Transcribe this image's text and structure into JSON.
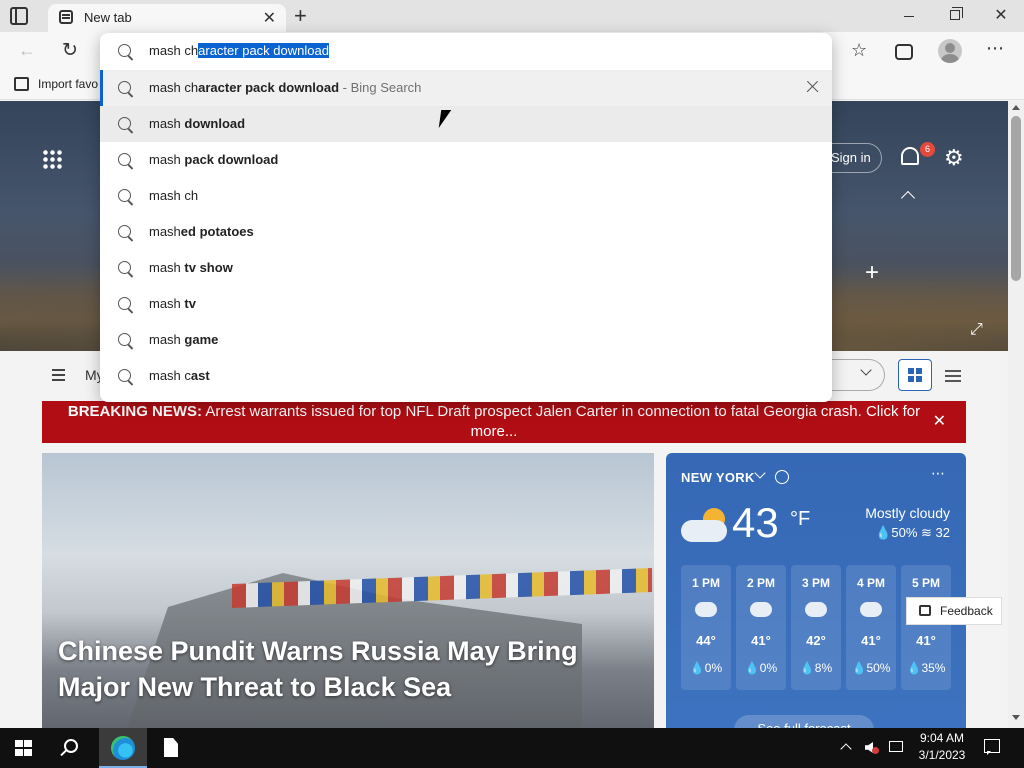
{
  "browser": {
    "tab_title": "New tab",
    "favorites_import_label": "Import favo"
  },
  "omnibox": {
    "query_typed": "mash ch",
    "query_autocomplete": "aracter pack download",
    "suggestions": [
      {
        "prefix": "mash ch",
        "bold": "aracter pack download",
        "suffix": " - Bing Search"
      },
      {
        "prefix": "mash ",
        "bold": "download",
        "suffix": ""
      },
      {
        "prefix": "mash ",
        "bold": "pack download",
        "suffix": ""
      },
      {
        "prefix": "mash ch",
        "bold": "",
        "suffix": ""
      },
      {
        "prefix": "mash",
        "bold": "ed potatoes",
        "suffix": ""
      },
      {
        "prefix": "mash ",
        "bold": "tv show",
        "suffix": ""
      },
      {
        "prefix": "mash ",
        "bold": "tv",
        "suffix": ""
      },
      {
        "prefix": "mash ",
        "bold": "game",
        "suffix": ""
      },
      {
        "prefix": "mash c",
        "bold": "ast",
        "suffix": ""
      }
    ]
  },
  "ntp": {
    "signin_label": "Sign in",
    "notification_count": "6",
    "feed_label": "My",
    "breaking_label": "BREAKING NEWS:",
    "breaking_text": " Arrest warrants issued for top NFL Draft prospect Jalen Carter in connection to fatal Georgia crash. Click for more...",
    "story_title": "Chinese Pundit Warns Russia May Bring Major New Threat to Black Sea",
    "feedback_label": "Feedback"
  },
  "weather": {
    "city": "NEW YORK",
    "temp": "43",
    "unit": "°F",
    "condition": "Mostly cloudy",
    "precip": "50%",
    "wind": "32",
    "hours": [
      {
        "time": "1 PM",
        "icon": "partly-sunny-icon",
        "temp": "44°",
        "precip": "0%"
      },
      {
        "time": "2 PM",
        "icon": "partly-sunny-icon",
        "temp": "41°",
        "precip": "0%"
      },
      {
        "time": "3 PM",
        "icon": "cloudy-icon",
        "temp": "42°",
        "precip": "8%"
      },
      {
        "time": "4 PM",
        "icon": "rain-icon",
        "temp": "41°",
        "precip": "50%"
      },
      {
        "time": "5 PM",
        "icon": "rain-icon",
        "temp": "41°",
        "precip": "35%"
      }
    ],
    "forecast_label": "See full forecast"
  },
  "taskbar": {
    "time": "9:04 AM",
    "date": "3/1/2023"
  },
  "colors": {
    "accent": "#0a63d1",
    "breaking_red": "#b00e14",
    "weather_blue": "#3568b5"
  }
}
